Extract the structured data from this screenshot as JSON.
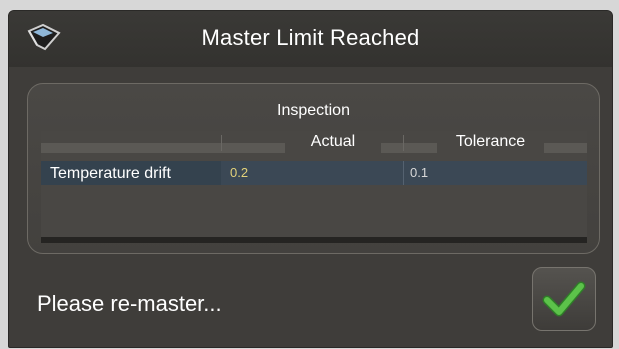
{
  "dialog": {
    "title": "Master Limit Reached",
    "title_icon": "pointer-tool-icon",
    "message": "Please re-master...",
    "ok_icon": "checkmark-icon",
    "colors": {
      "background": "#3f3d3a",
      "row_highlight": "#3b4855",
      "actual_value": "#e3d27a",
      "check_green": "#4caf3e"
    }
  },
  "inspection": {
    "title": "Inspection",
    "columns": [
      "",
      "Actual",
      "Tolerance"
    ],
    "rows": [
      {
        "label": "Temperature drift",
        "actual": "0.2",
        "tolerance": "0.1"
      }
    ]
  }
}
